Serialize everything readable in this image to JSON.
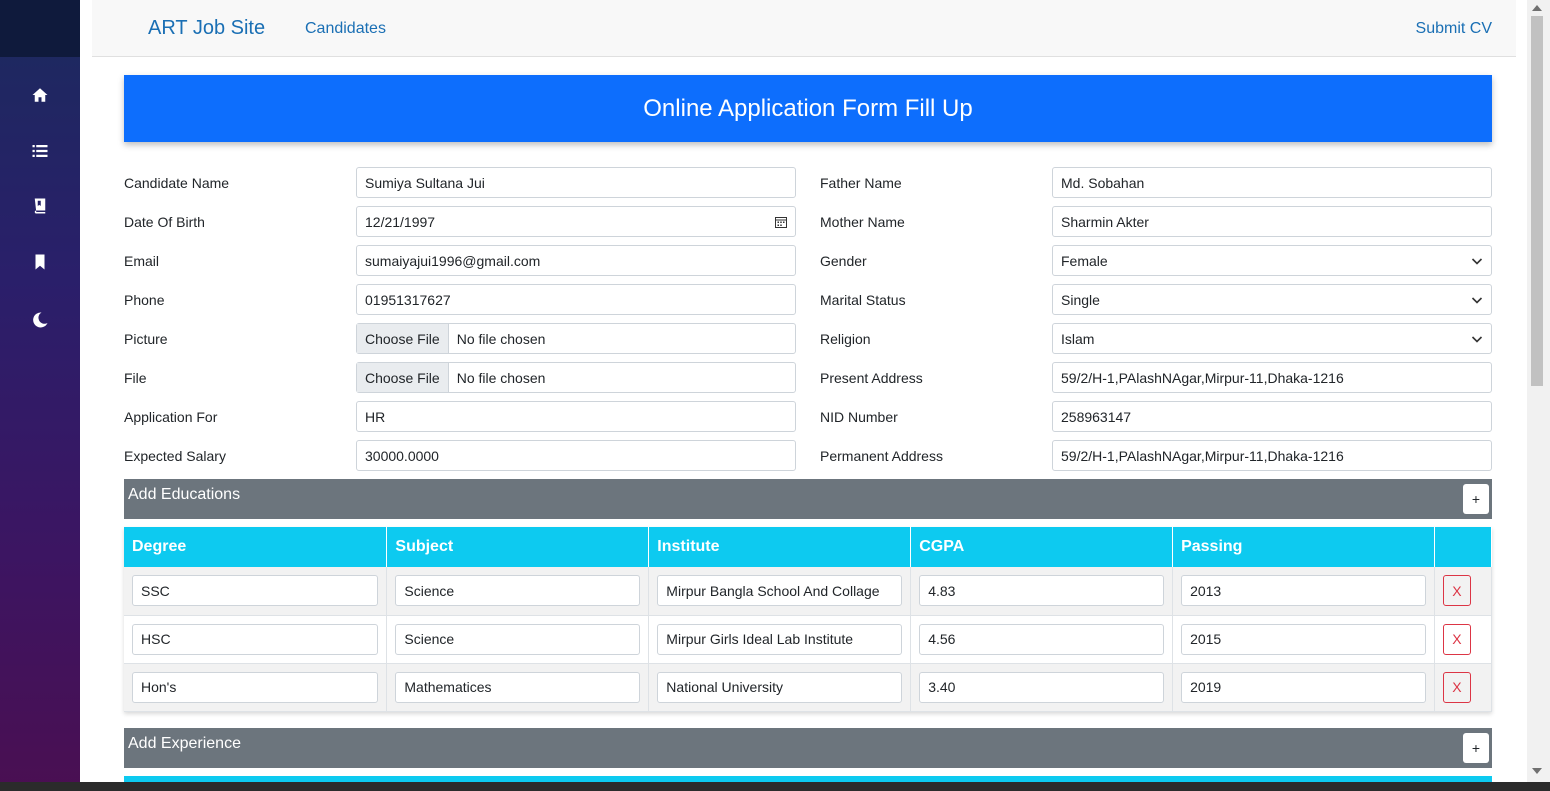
{
  "nav": {
    "brand": "ART Job Site",
    "candidates": "Candidates",
    "submit_cv": "Submit CV"
  },
  "sidebar": {
    "icons": [
      "home-icon",
      "list-icon",
      "book-icon",
      "bookmark-icon",
      "moon-icon"
    ]
  },
  "banner": {
    "title": "Online Application Form Fill Up"
  },
  "form": {
    "left": [
      {
        "label": "Candidate Name",
        "value": "Sumiya Sultana Jui"
      },
      {
        "label": "Date Of Birth",
        "value": "12/21/1997"
      },
      {
        "label": "Email",
        "value": "sumaiyajui1996@gmail.com"
      },
      {
        "label": "Phone",
        "value": "01951317627"
      },
      {
        "label": "Picture",
        "button": "Choose File",
        "value": "No file chosen"
      },
      {
        "label": "File",
        "button": "Choose File",
        "value": "No file chosen"
      },
      {
        "label": "Application For",
        "value": "HR"
      },
      {
        "label": "Expected Salary",
        "value": "30000.0000"
      }
    ],
    "right": [
      {
        "label": "Father Name",
        "value": "Md. Sobahan"
      },
      {
        "label": "Mother Name",
        "value": "Sharmin Akter"
      },
      {
        "label": "Gender",
        "value": "Female"
      },
      {
        "label": "Marital Status",
        "value": "Single"
      },
      {
        "label": "Religion",
        "value": "Islam"
      },
      {
        "label": "Present Address",
        "value": "59/2/H-1,PAlashNAgar,Mirpur-11,Dhaka-1216"
      },
      {
        "label": "NID Number",
        "value": "258963147"
      },
      {
        "label": "Permanent Address",
        "value": "59/2/H-1,PAlashNAgar,Mirpur-11,Dhaka-1216"
      }
    ]
  },
  "educations": {
    "title": "Add Educations",
    "add_label": "+",
    "headers": [
      "Degree",
      "Subject",
      "Institute",
      "CGPA",
      "Passing"
    ],
    "rows": [
      {
        "degree": "SSC",
        "subject": "Science",
        "institute": "Mirpur Bangla School And Collage",
        "cgpa": "4.83",
        "passing": "2013"
      },
      {
        "degree": "HSC",
        "subject": "Science",
        "institute": "Mirpur Girls Ideal Lab Institute",
        "cgpa": "4.56",
        "passing": "2015"
      },
      {
        "degree": "Hon's",
        "subject": "Mathematices",
        "institute": "National University",
        "cgpa": "3.40",
        "passing": "2019"
      }
    ],
    "delete_label": "X"
  },
  "experience": {
    "title": "Add Experience",
    "add_label": "+"
  },
  "colors": {
    "primary": "#0d6efd",
    "info": "#0dcaf0",
    "secondary": "#6c757d",
    "danger": "#dc3545",
    "link": "#1a6fb4"
  }
}
